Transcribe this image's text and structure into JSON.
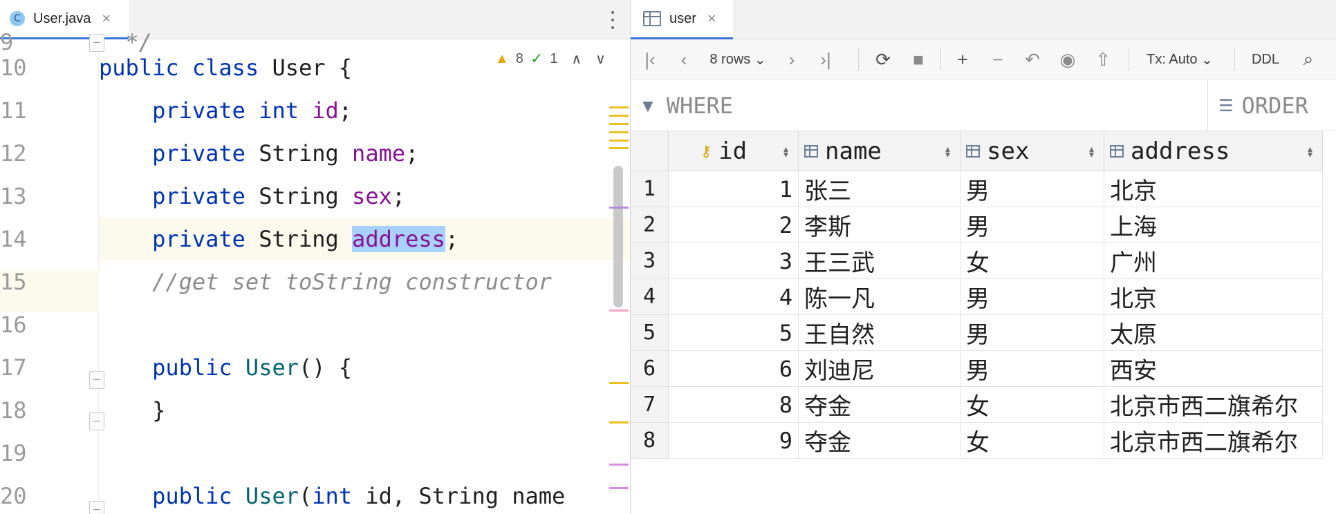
{
  "editor": {
    "tab_label": "User.java",
    "file_icon_letter": "C",
    "inspections": {
      "warnings": "8",
      "weak_warnings": "1"
    },
    "line_numbers": [
      "9",
      "10",
      "11",
      "12",
      "13",
      "14",
      "15",
      "16",
      "17",
      "18",
      "19",
      "20"
    ],
    "top_partial": "*/",
    "lines": {
      "l10": {
        "kw1": "public",
        "kw2": "class",
        "name": "User {"
      },
      "l11": {
        "kw1": "private",
        "kw2": "int",
        "field": "id",
        "end": ";"
      },
      "l12": {
        "kw1": "private",
        "type": "String",
        "field": "name",
        "end": ";"
      },
      "l13": {
        "kw1": "private",
        "type": "String",
        "field": "sex",
        "end": ";"
      },
      "l14": {
        "kw1": "private",
        "type": "String",
        "field": "address",
        "end": ";"
      },
      "l15": {
        "comment": "//get set toString constructor"
      },
      "l17": {
        "kw1": "public",
        "ctor": "User",
        "rest": "() {"
      },
      "l18": {
        "brace": "}"
      },
      "l20": {
        "kw1": "public",
        "ctor": "User",
        "p1": "(",
        "kw2": "int",
        "rest1": " id, String name"
      }
    },
    "colors": {
      "keyword": "#0033b3",
      "field": "#871094",
      "selection": "#a8d1ff",
      "current_line": "#fcfaed"
    }
  },
  "db": {
    "tab_label": "user",
    "toolbar": {
      "rows_label": "8 rows",
      "tx_label": "Tx: Auto",
      "ddl_label": "DDL"
    },
    "filter": {
      "where_placeholder": "WHERE",
      "order_placeholder": "ORDER"
    },
    "columns": [
      "id",
      "name",
      "sex",
      "address"
    ],
    "rows": [
      {
        "n": "1",
        "id": "1",
        "name": "张三",
        "sex": "男",
        "address": "北京"
      },
      {
        "n": "2",
        "id": "2",
        "name": "李斯",
        "sex": "男",
        "address": "上海"
      },
      {
        "n": "3",
        "id": "3",
        "name": "王三武",
        "sex": "女",
        "address": "广州"
      },
      {
        "n": "4",
        "id": "4",
        "name": "陈一凡",
        "sex": "男",
        "address": "北京"
      },
      {
        "n": "5",
        "id": "5",
        "name": "王自然",
        "sex": "男",
        "address": "太原"
      },
      {
        "n": "6",
        "id": "6",
        "name": "刘迪尼",
        "sex": "男",
        "address": "西安"
      },
      {
        "n": "7",
        "id": "8",
        "name": "夺金",
        "sex": "女",
        "address": "北京市西二旗希尔"
      },
      {
        "n": "8",
        "id": "9",
        "name": "夺金",
        "sex": "女",
        "address": "北京市西二旗希尔"
      }
    ]
  }
}
